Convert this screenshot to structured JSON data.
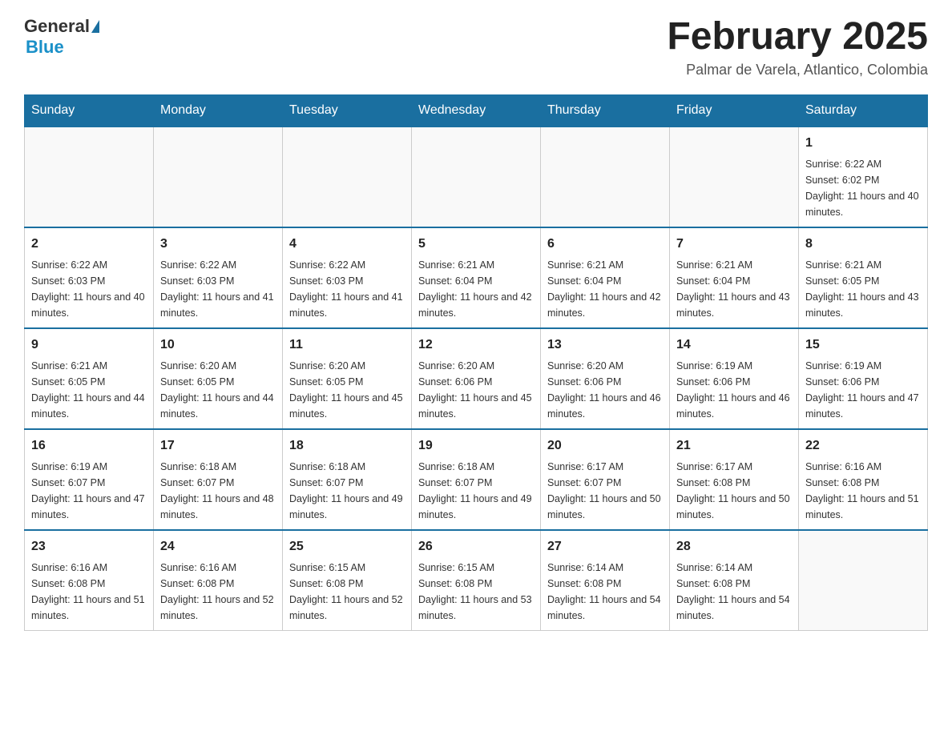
{
  "header": {
    "logo": {
      "general": "General",
      "blue": "Blue"
    },
    "title": "February 2025",
    "location": "Palmar de Varela, Atlantico, Colombia"
  },
  "weekdays": [
    "Sunday",
    "Monday",
    "Tuesday",
    "Wednesday",
    "Thursday",
    "Friday",
    "Saturday"
  ],
  "weeks": [
    [
      {
        "day": "",
        "sunrise": "",
        "sunset": "",
        "daylight": ""
      },
      {
        "day": "",
        "sunrise": "",
        "sunset": "",
        "daylight": ""
      },
      {
        "day": "",
        "sunrise": "",
        "sunset": "",
        "daylight": ""
      },
      {
        "day": "",
        "sunrise": "",
        "sunset": "",
        "daylight": ""
      },
      {
        "day": "",
        "sunrise": "",
        "sunset": "",
        "daylight": ""
      },
      {
        "day": "",
        "sunrise": "",
        "sunset": "",
        "daylight": ""
      },
      {
        "day": "1",
        "sunrise": "Sunrise: 6:22 AM",
        "sunset": "Sunset: 6:02 PM",
        "daylight": "Daylight: 11 hours and 40 minutes."
      }
    ],
    [
      {
        "day": "2",
        "sunrise": "Sunrise: 6:22 AM",
        "sunset": "Sunset: 6:03 PM",
        "daylight": "Daylight: 11 hours and 40 minutes."
      },
      {
        "day": "3",
        "sunrise": "Sunrise: 6:22 AM",
        "sunset": "Sunset: 6:03 PM",
        "daylight": "Daylight: 11 hours and 41 minutes."
      },
      {
        "day": "4",
        "sunrise": "Sunrise: 6:22 AM",
        "sunset": "Sunset: 6:03 PM",
        "daylight": "Daylight: 11 hours and 41 minutes."
      },
      {
        "day": "5",
        "sunrise": "Sunrise: 6:21 AM",
        "sunset": "Sunset: 6:04 PM",
        "daylight": "Daylight: 11 hours and 42 minutes."
      },
      {
        "day": "6",
        "sunrise": "Sunrise: 6:21 AM",
        "sunset": "Sunset: 6:04 PM",
        "daylight": "Daylight: 11 hours and 42 minutes."
      },
      {
        "day": "7",
        "sunrise": "Sunrise: 6:21 AM",
        "sunset": "Sunset: 6:04 PM",
        "daylight": "Daylight: 11 hours and 43 minutes."
      },
      {
        "day": "8",
        "sunrise": "Sunrise: 6:21 AM",
        "sunset": "Sunset: 6:05 PM",
        "daylight": "Daylight: 11 hours and 43 minutes."
      }
    ],
    [
      {
        "day": "9",
        "sunrise": "Sunrise: 6:21 AM",
        "sunset": "Sunset: 6:05 PM",
        "daylight": "Daylight: 11 hours and 44 minutes."
      },
      {
        "day": "10",
        "sunrise": "Sunrise: 6:20 AM",
        "sunset": "Sunset: 6:05 PM",
        "daylight": "Daylight: 11 hours and 44 minutes."
      },
      {
        "day": "11",
        "sunrise": "Sunrise: 6:20 AM",
        "sunset": "Sunset: 6:05 PM",
        "daylight": "Daylight: 11 hours and 45 minutes."
      },
      {
        "day": "12",
        "sunrise": "Sunrise: 6:20 AM",
        "sunset": "Sunset: 6:06 PM",
        "daylight": "Daylight: 11 hours and 45 minutes."
      },
      {
        "day": "13",
        "sunrise": "Sunrise: 6:20 AM",
        "sunset": "Sunset: 6:06 PM",
        "daylight": "Daylight: 11 hours and 46 minutes."
      },
      {
        "day": "14",
        "sunrise": "Sunrise: 6:19 AM",
        "sunset": "Sunset: 6:06 PM",
        "daylight": "Daylight: 11 hours and 46 minutes."
      },
      {
        "day": "15",
        "sunrise": "Sunrise: 6:19 AM",
        "sunset": "Sunset: 6:06 PM",
        "daylight": "Daylight: 11 hours and 47 minutes."
      }
    ],
    [
      {
        "day": "16",
        "sunrise": "Sunrise: 6:19 AM",
        "sunset": "Sunset: 6:07 PM",
        "daylight": "Daylight: 11 hours and 47 minutes."
      },
      {
        "day": "17",
        "sunrise": "Sunrise: 6:18 AM",
        "sunset": "Sunset: 6:07 PM",
        "daylight": "Daylight: 11 hours and 48 minutes."
      },
      {
        "day": "18",
        "sunrise": "Sunrise: 6:18 AM",
        "sunset": "Sunset: 6:07 PM",
        "daylight": "Daylight: 11 hours and 49 minutes."
      },
      {
        "day": "19",
        "sunrise": "Sunrise: 6:18 AM",
        "sunset": "Sunset: 6:07 PM",
        "daylight": "Daylight: 11 hours and 49 minutes."
      },
      {
        "day": "20",
        "sunrise": "Sunrise: 6:17 AM",
        "sunset": "Sunset: 6:07 PM",
        "daylight": "Daylight: 11 hours and 50 minutes."
      },
      {
        "day": "21",
        "sunrise": "Sunrise: 6:17 AM",
        "sunset": "Sunset: 6:08 PM",
        "daylight": "Daylight: 11 hours and 50 minutes."
      },
      {
        "day": "22",
        "sunrise": "Sunrise: 6:16 AM",
        "sunset": "Sunset: 6:08 PM",
        "daylight": "Daylight: 11 hours and 51 minutes."
      }
    ],
    [
      {
        "day": "23",
        "sunrise": "Sunrise: 6:16 AM",
        "sunset": "Sunset: 6:08 PM",
        "daylight": "Daylight: 11 hours and 51 minutes."
      },
      {
        "day": "24",
        "sunrise": "Sunrise: 6:16 AM",
        "sunset": "Sunset: 6:08 PM",
        "daylight": "Daylight: 11 hours and 52 minutes."
      },
      {
        "day": "25",
        "sunrise": "Sunrise: 6:15 AM",
        "sunset": "Sunset: 6:08 PM",
        "daylight": "Daylight: 11 hours and 52 minutes."
      },
      {
        "day": "26",
        "sunrise": "Sunrise: 6:15 AM",
        "sunset": "Sunset: 6:08 PM",
        "daylight": "Daylight: 11 hours and 53 minutes."
      },
      {
        "day": "27",
        "sunrise": "Sunrise: 6:14 AM",
        "sunset": "Sunset: 6:08 PM",
        "daylight": "Daylight: 11 hours and 54 minutes."
      },
      {
        "day": "28",
        "sunrise": "Sunrise: 6:14 AM",
        "sunset": "Sunset: 6:08 PM",
        "daylight": "Daylight: 11 hours and 54 minutes."
      },
      {
        "day": "",
        "sunrise": "",
        "sunset": "",
        "daylight": ""
      }
    ]
  ]
}
